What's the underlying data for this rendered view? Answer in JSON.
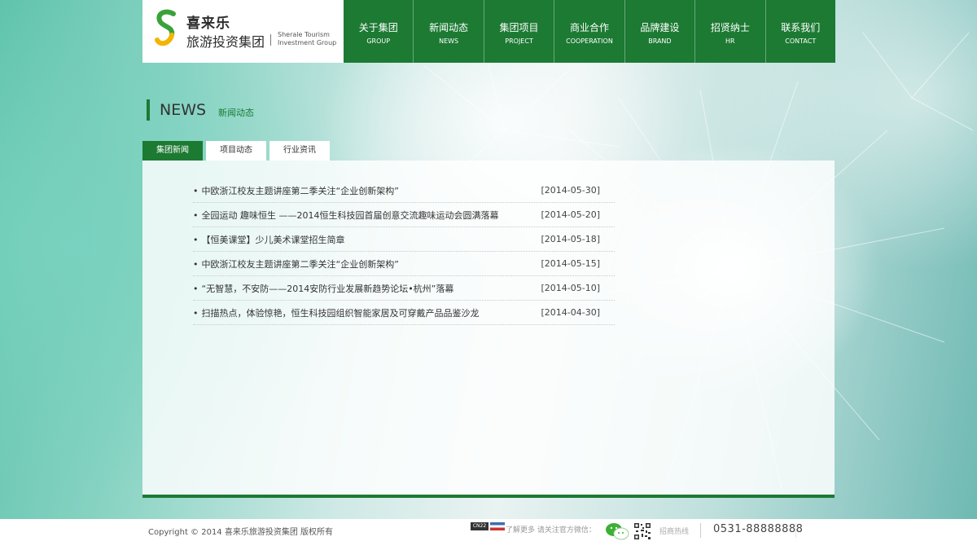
{
  "brand": {
    "name_cn_line1": "喜来乐",
    "name_cn_line2": "旅游投资集团",
    "name_en_line1": "Sherale Tourism",
    "name_en_line2": "Investment Group",
    "colors": {
      "primary": "#1c7a33",
      "logo_green": "#3aa23a",
      "logo_yellow": "#f4b400"
    }
  },
  "nav": [
    {
      "cn": "关于集团",
      "en": "GROUP"
    },
    {
      "cn": "新闻动态",
      "en": "NEWS"
    },
    {
      "cn": "集团项目",
      "en": "PROJECT"
    },
    {
      "cn": "商业合作",
      "en": "COOPERATION"
    },
    {
      "cn": "品牌建设",
      "en": "BRAND"
    },
    {
      "cn": "招贤纳士",
      "en": "HR"
    },
    {
      "cn": "联系我们",
      "en": "CONTACT"
    }
  ],
  "section": {
    "title": "NEWS",
    "subtitle": "新闻动态"
  },
  "tabs": [
    {
      "label": "集团新闻",
      "active": true
    },
    {
      "label": "项目动态",
      "active": false
    },
    {
      "label": "行业资讯",
      "active": false
    }
  ],
  "news": [
    {
      "title": "中欧浙江校友主题讲座第二季关注“企业创新架构”",
      "date": "[2014-05-30]"
    },
    {
      "title": "全园运动 趣味恒生 ——2014恒生科技园首届创意交流趣味运动会圆满落幕",
      "date": "[2014-05-20]"
    },
    {
      "title": "【恒美课堂】少儿美术课堂招生简章",
      "date": "[2014-05-18]"
    },
    {
      "title": "中欧浙江校友主题讲座第二季关注“企业创新架构”",
      "date": "[2014-05-15]"
    },
    {
      "title": "“无智慧，不安防——2014安防行业发展新趋势论坛•杭州”落幕",
      "date": "[2014-05-10]"
    },
    {
      "title": "扫描热点，体验惊艳，恒生科技园组织智能家居及可穿戴产品品鉴沙龙",
      "date": "[2014-04-30]"
    }
  ],
  "footer": {
    "copyright": "Copyright © 2014  喜来乐旅游投资集团 版权所有",
    "badge_cn22": "CN22",
    "follow_text": "了解更多 请关注官方微信：",
    "hotline_label": "招商热线",
    "phone": "0531-88888888"
  },
  "icons": {
    "wechat": "wechat-icon",
    "qr": "qr-code-icon",
    "logo": "logo-s-mark-icon"
  }
}
